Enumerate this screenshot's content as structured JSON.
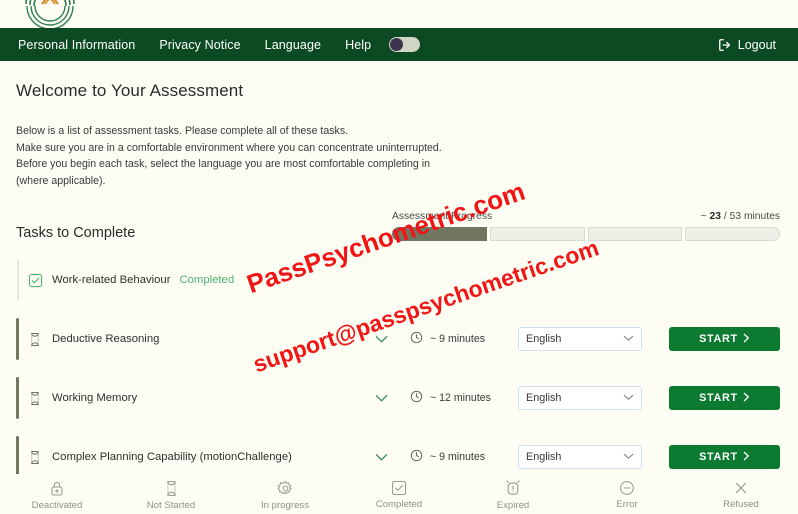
{
  "brand": {
    "logo_icon": "crest-logo",
    "nav_bg": "#0b4a23",
    "accent_green": "#0c7a31",
    "completed_green": "#4fb274",
    "progress_fill": "#70765f"
  },
  "navbar": {
    "links": [
      {
        "label": "Personal Information",
        "name": "nav-personal-information"
      },
      {
        "label": "Privacy Notice",
        "name": "nav-privacy-notice"
      },
      {
        "label": "Language",
        "name": "nav-language"
      },
      {
        "label": "Help",
        "name": "nav-help"
      }
    ],
    "toggle": {
      "name": "theme-toggle",
      "state": "off"
    },
    "logout": {
      "label": "Logout",
      "icon": "logout-icon"
    }
  },
  "page": {
    "title": "Welcome to Your Assessment",
    "intro_lines": [
      "Below is a list of assessment tasks. Please complete all of these tasks.",
      "Make sure you are in a comfortable environment where you can concentrate uninterrupted.",
      "Before you begin each task, select the language you are most comfortable completing in",
      "(where applicable)."
    ],
    "tasks_heading": "Tasks to Complete"
  },
  "progress": {
    "label": "Assessment Progress",
    "elapsed_prefix": "~",
    "elapsed": "23",
    "separator": "/",
    "total": "53 minutes",
    "segments": [
      {
        "filled": true
      },
      {
        "filled": false
      },
      {
        "filled": false
      },
      {
        "filled": false
      }
    ]
  },
  "tasks": [
    {
      "name": "Work-related Behaviour",
      "status": "completed",
      "status_label": "Completed",
      "icon": "checkbox-checked-icon",
      "has_controls": false,
      "duration": "",
      "language": "",
      "start_label": ""
    },
    {
      "name": "Deductive Reasoning",
      "status": "not-started",
      "status_label": "",
      "icon": "hourglass-icon",
      "has_controls": true,
      "duration": "~ 9 minutes",
      "language": "English",
      "start_label": "START"
    },
    {
      "name": "Working Memory",
      "status": "not-started",
      "status_label": "",
      "icon": "hourglass-icon",
      "has_controls": true,
      "duration": "~ 12 minutes",
      "language": "English",
      "start_label": "START"
    },
    {
      "name": "Complex Planning Capability (motionChallenge)",
      "status": "not-started",
      "status_label": "",
      "icon": "hourglass-icon",
      "has_controls": true,
      "duration": "~ 9 minutes",
      "language": "English",
      "start_label": "START"
    }
  ],
  "legend": [
    {
      "label": "Deactivated",
      "icon": "lock-icon"
    },
    {
      "label": "Not Started",
      "icon": "hourglass-icon"
    },
    {
      "label": "In progress",
      "icon": "gear-icon"
    },
    {
      "label": "Completed",
      "icon": "checkbox-checked-icon"
    },
    {
      "label": "Expired",
      "icon": "alarm-clock-icon"
    },
    {
      "label": "Error",
      "icon": "minus-circle-icon"
    },
    {
      "label": "Refused",
      "icon": "close-x-icon"
    }
  ],
  "watermarks": {
    "line1": "PassPsychometric.com",
    "line2": "support@passpsychometric.com"
  }
}
